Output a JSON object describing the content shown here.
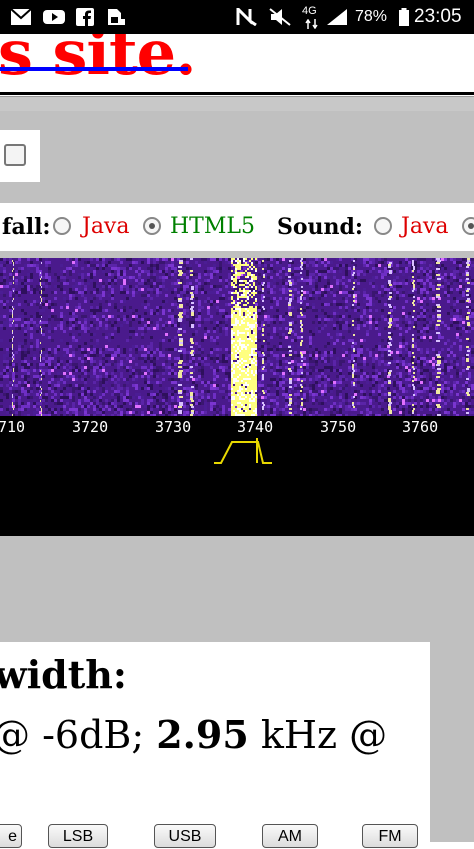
{
  "status_bar": {
    "icons": [
      "gmail-icon",
      "youtube-icon",
      "facebook-icon",
      "sim-card-icon",
      "nfc-icon",
      "mute-icon",
      "network-4g-icon",
      "signal-icon",
      "battery-icon"
    ],
    "network": "4G",
    "battery": "78%",
    "time": "23:05"
  },
  "page": {
    "title": "s site."
  },
  "options": {
    "waterfall_label": "fall:",
    "waterfall_opt1": "Java",
    "waterfall_opt2": "HTML5",
    "waterfall_selected": "HTML5",
    "sound_label": "Sound:",
    "sound_opt1": "Java",
    "colors": {
      "java": "#dd0000",
      "html5": "#008000"
    }
  },
  "waterfall": {
    "scale_labels": [
      "710",
      "3720",
      "3730",
      "3740",
      "3750",
      "3760"
    ],
    "colors": {
      "background": "#4a1a8c",
      "signal": "#ffff80"
    }
  },
  "bandwidth": {
    "title": "width:",
    "prefix": "@ -6dB; ",
    "value": "2.95",
    "suffix": " kHz @"
  },
  "modes": [
    "e",
    "LSB",
    "USB",
    "AM",
    "FM"
  ]
}
